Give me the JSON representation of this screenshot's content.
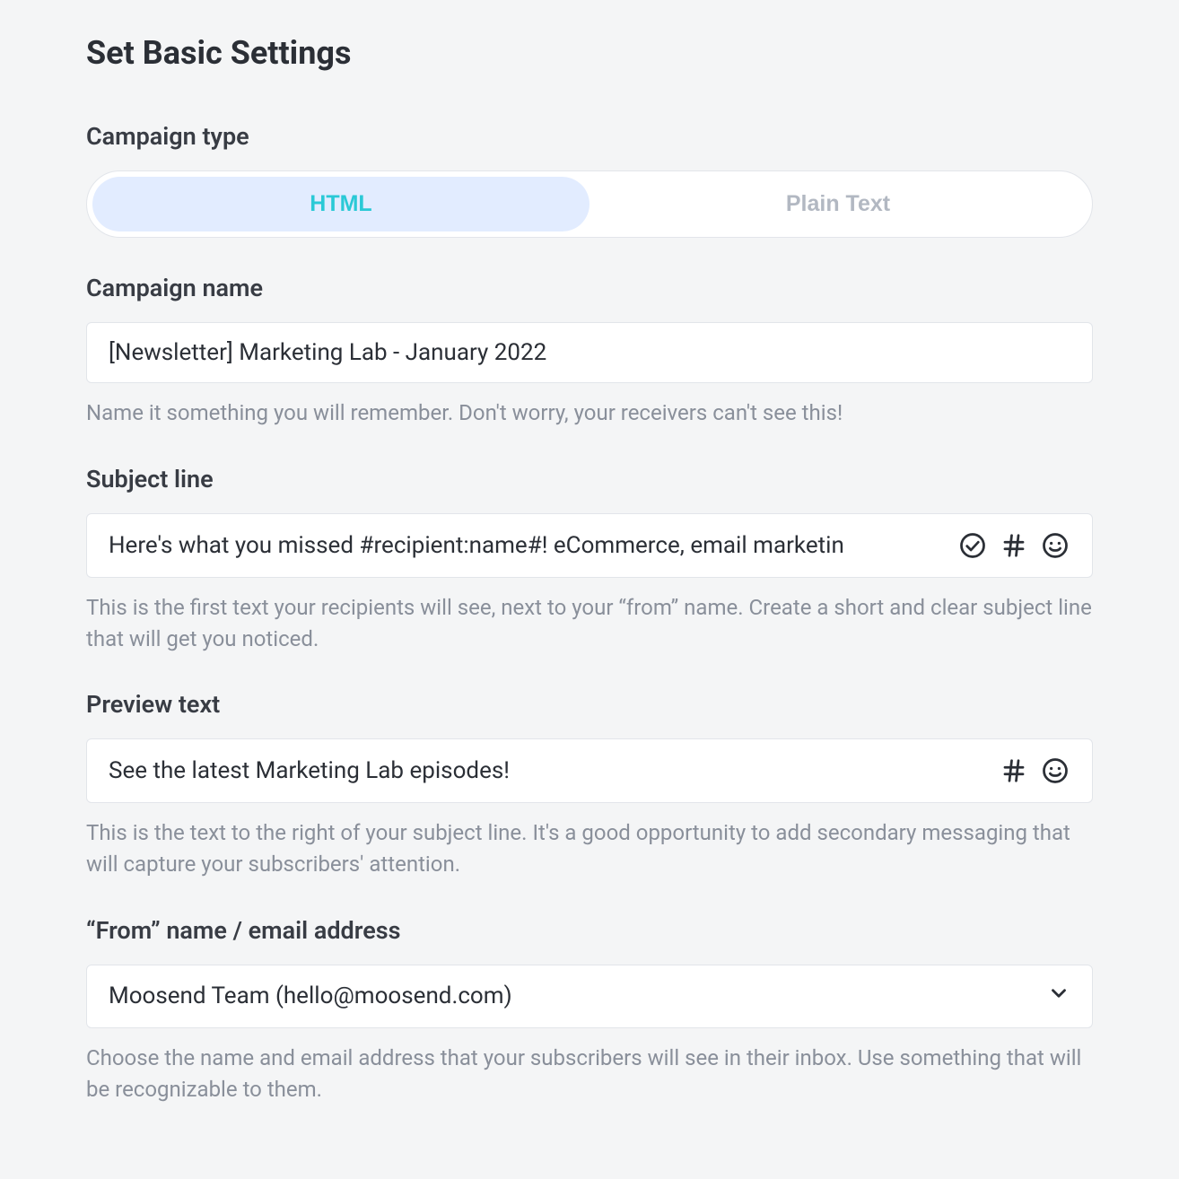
{
  "title": "Set Basic Settings",
  "campaign_type": {
    "label": "Campaign type",
    "options": {
      "html": "HTML",
      "plain": "Plain Text"
    }
  },
  "campaign_name": {
    "label": "Campaign name",
    "value": "[Newsletter] Marketing Lab - January 2022",
    "help": "Name it something you will remember. Don't worry, your receivers can't see this!"
  },
  "subject_line": {
    "label": "Subject line",
    "value": "Here's what you missed #recipient:name#! eCommerce, email marketin",
    "help": "This is the first text your recipients will see, next to your “from” name. Create a short and clear subject line that will get you noticed."
  },
  "preview_text": {
    "label": "Preview text",
    "value": "See the latest Marketing Lab episodes!",
    "help": "This is the text to the right of your subject line. It's a good opportunity to add secondary messaging that will capture your subscribers' attention."
  },
  "from": {
    "label": "“From” name / email address",
    "value": "Moosend Team (hello@moosend.com)",
    "help": "Choose the name and email address that your subscribers will see in their inbox. Use something that will be recognizable to them."
  }
}
